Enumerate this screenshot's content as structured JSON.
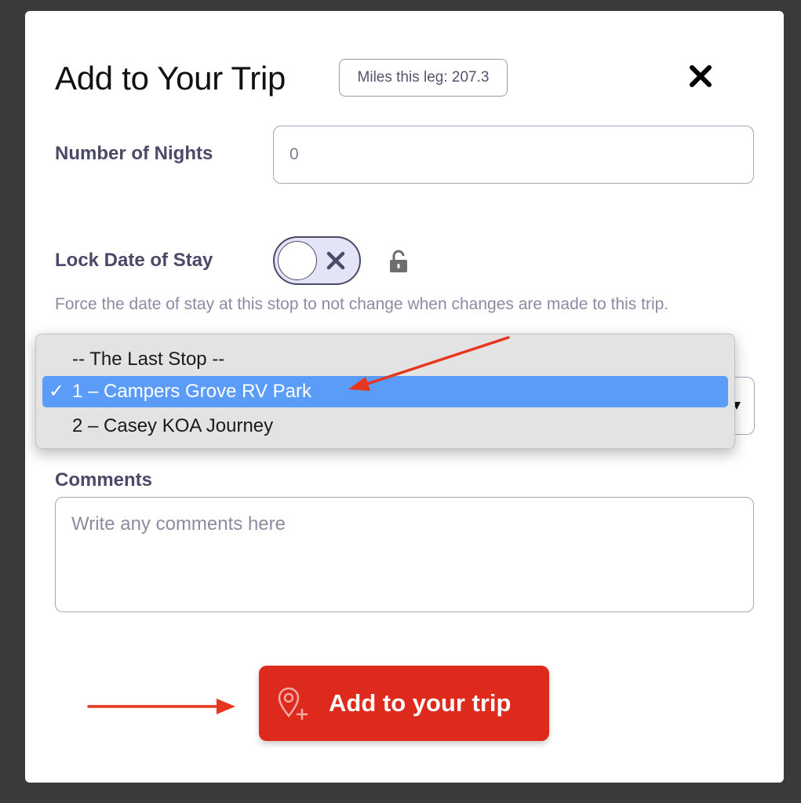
{
  "modal": {
    "title": "Add to Your Trip",
    "miles_badge": "Miles this leg: 207.3"
  },
  "nights": {
    "label": "Number of Nights",
    "value": "0"
  },
  "lock": {
    "label": "Lock Date of Stay",
    "toggle_on": false,
    "help": "Force the date of stay at this stop to not change when changes are made to this trip."
  },
  "stop_select": {
    "options": [
      {
        "label": "-- The Last Stop --",
        "selected": false
      },
      {
        "label": "1 – Campers Grove RV Park",
        "selected": true
      },
      {
        "label": "2 – Casey KOA Journey",
        "selected": false
      }
    ],
    "check_glyph": "✓"
  },
  "comments": {
    "label": "Comments",
    "placeholder": "Write any comments here"
  },
  "submit": {
    "label": "Add to your trip"
  },
  "colors": {
    "primary_button": "#dd2a1d",
    "highlight": "#5a9cf8",
    "label_text": "#4a4968",
    "annotation_arrow": "#e8351e"
  },
  "icons": [
    "close-icon",
    "toggle-x-icon",
    "lock-open-icon",
    "dropdown-caret-icon",
    "map-pin-plus-icon",
    "annotation-arrow"
  ]
}
